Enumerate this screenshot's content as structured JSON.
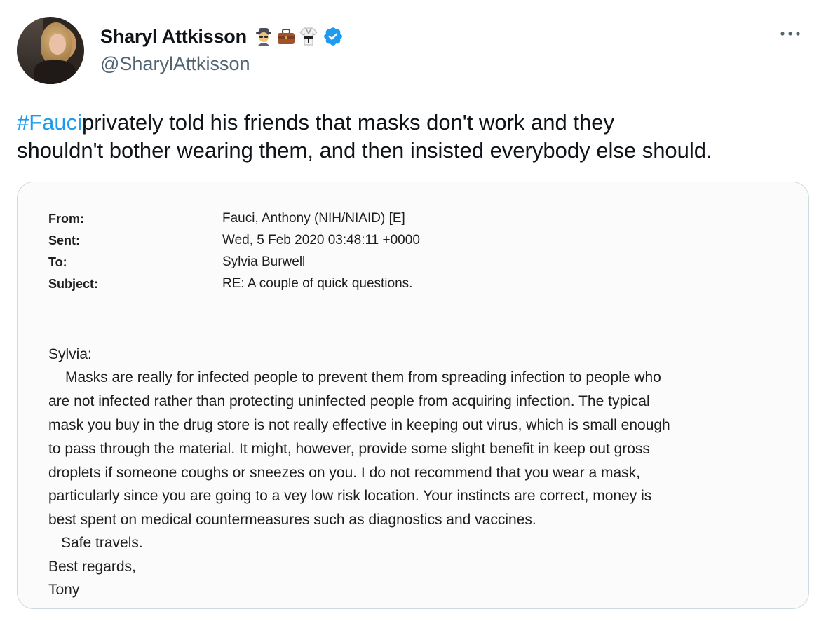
{
  "author": {
    "name": "Sharyl Attkisson",
    "handle": "@SharylAttkisson",
    "badges": [
      "detective-emoji",
      "briefcase-emoji",
      "martial-arts-uniform-emoji",
      "verified-badge"
    ],
    "verified_color": "#1d9bf0"
  },
  "tweet": {
    "hashtag": "#Fauci",
    "text_after_hashtag": " privately told his friends that masks don't work and they",
    "text_line2": "shouldn't bother wearing them, and then insisted everybody else should."
  },
  "email": {
    "headers": [
      {
        "label": "From:",
        "value": "Fauci, Anthony (NIH/NIAID) [E]"
      },
      {
        "label": "Sent:",
        "value": "Wed, 5 Feb 2020 03:48:11 +0000"
      },
      {
        "label": "To:",
        "value": "Sylvia Burwell"
      },
      {
        "label": "Subject:",
        "value": "RE: A couple of quick questions."
      }
    ],
    "lines": [
      "Sylvia:",
      "    Masks are really for infected people to prevent them from spreading infection to people who",
      "are not infected rather than protecting uninfected people from acquiring infection.   The typical",
      "mask you buy in the drug store is not really effective in  keeping out virus, which is small enough",
      "to pass through the material.   It might, however, provide some slight benefit in keep out gross",
      "droplets if someone coughs or sneezes on you.  I do not recommend that you wear a mask,",
      "particularly since you are going to a vey low risk location.   Your instincts are correct, money is",
      "best spent on medical countermeasures such as diagnostics and vaccines.",
      "   Safe travels.",
      "Best regards,",
      "Tony"
    ]
  },
  "colors": {
    "text": "#0f1419",
    "secondary": "#536471",
    "link": "#1d9bf0",
    "border": "#cfd9de"
  }
}
